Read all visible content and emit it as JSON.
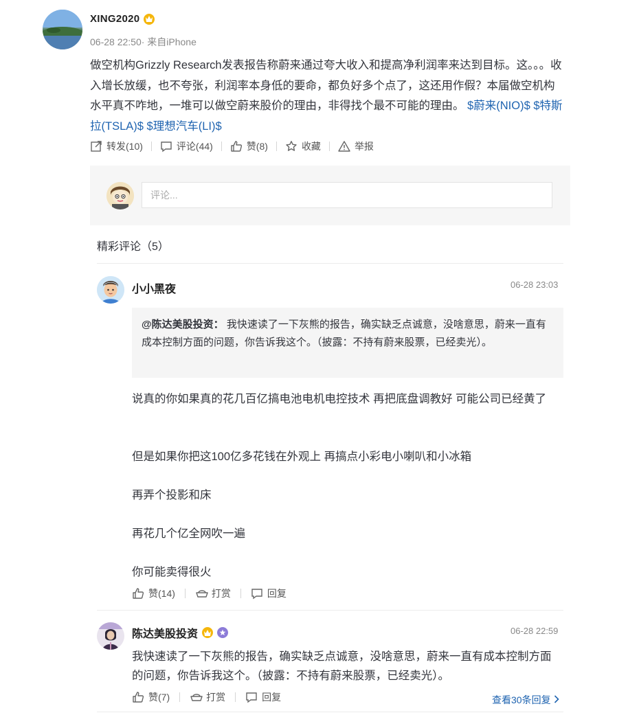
{
  "post": {
    "author": "XING2020",
    "meta": "06-28 22:50· 来自iPhone",
    "text_parts": {
      "body": "做空机构Grizzly Research发表报告称蔚来通过夸大收入和提高净利润率来达到目标。这。。。收入增长放缓，也不夸张，利润率本身低的要命，都负好多个点了，这还用作假？本届做空机构水平真不咋地，一堆可以做空蔚来股价的理由，非得找个最不可能的理由。",
      "tag1": "$蔚来(NIO)$",
      "tag2": "$特斯拉(TSLA)$",
      "tag3": "$理想汽车(LI)$"
    },
    "actions": {
      "repost": "转发(10)",
      "comment": "评论(44)",
      "like": "赞(8)",
      "favorite": "收藏",
      "report": "举报"
    }
  },
  "comment_input": {
    "placeholder": "评论..."
  },
  "hot_comments": {
    "title": "精彩评论（5）"
  },
  "comments": [
    {
      "name": "小小黑夜",
      "time": "06-28 23:03",
      "quote_author": "@陈达美股投资：",
      "quote_text": "我快速读了一下灰熊的报告，确实缺乏点诚意，没啥意思，蔚来一直有成本控制方面的问题，你告诉我这个。（披露：不持有蔚来股票，已经卖光）。",
      "paragraphs": [
        "说真的你如果真的花几百亿搞电池电机电控技术 再把底盘调教好 可能公司已经黄了",
        "但是如果你把这100亿多花钱在外观上 再搞点小彩电小喇叭和小冰箱",
        "再弄个投影和床",
        "再花几个亿全网吹一遍",
        "你可能卖得很火"
      ],
      "like": "赞(14)",
      "reward": "打赏",
      "reply": "回复"
    },
    {
      "name": "陈达美股投资",
      "time": "06-28 22:59",
      "text": "我快速读了一下灰熊的报告，确实缺乏点诚意，没啥意思，蔚来一直有成本控制方面的问题，你告诉我这个。（披露：不持有蔚来股票，已经卖光）。",
      "like": "赞(7)",
      "reward": "打赏",
      "reply": "回复",
      "more_replies": "查看30条回复"
    }
  ],
  "colors": {
    "link": "#1e63b0",
    "crown": "#f5b60b",
    "verified": "#8c7bd8"
  },
  "icons": [
    "repost-icon",
    "comment-icon",
    "like-icon",
    "star-icon",
    "warning-icon",
    "reward-icon",
    "reply-icon",
    "chevron-right-icon",
    "crown-icon",
    "verified-badge-icon"
  ]
}
